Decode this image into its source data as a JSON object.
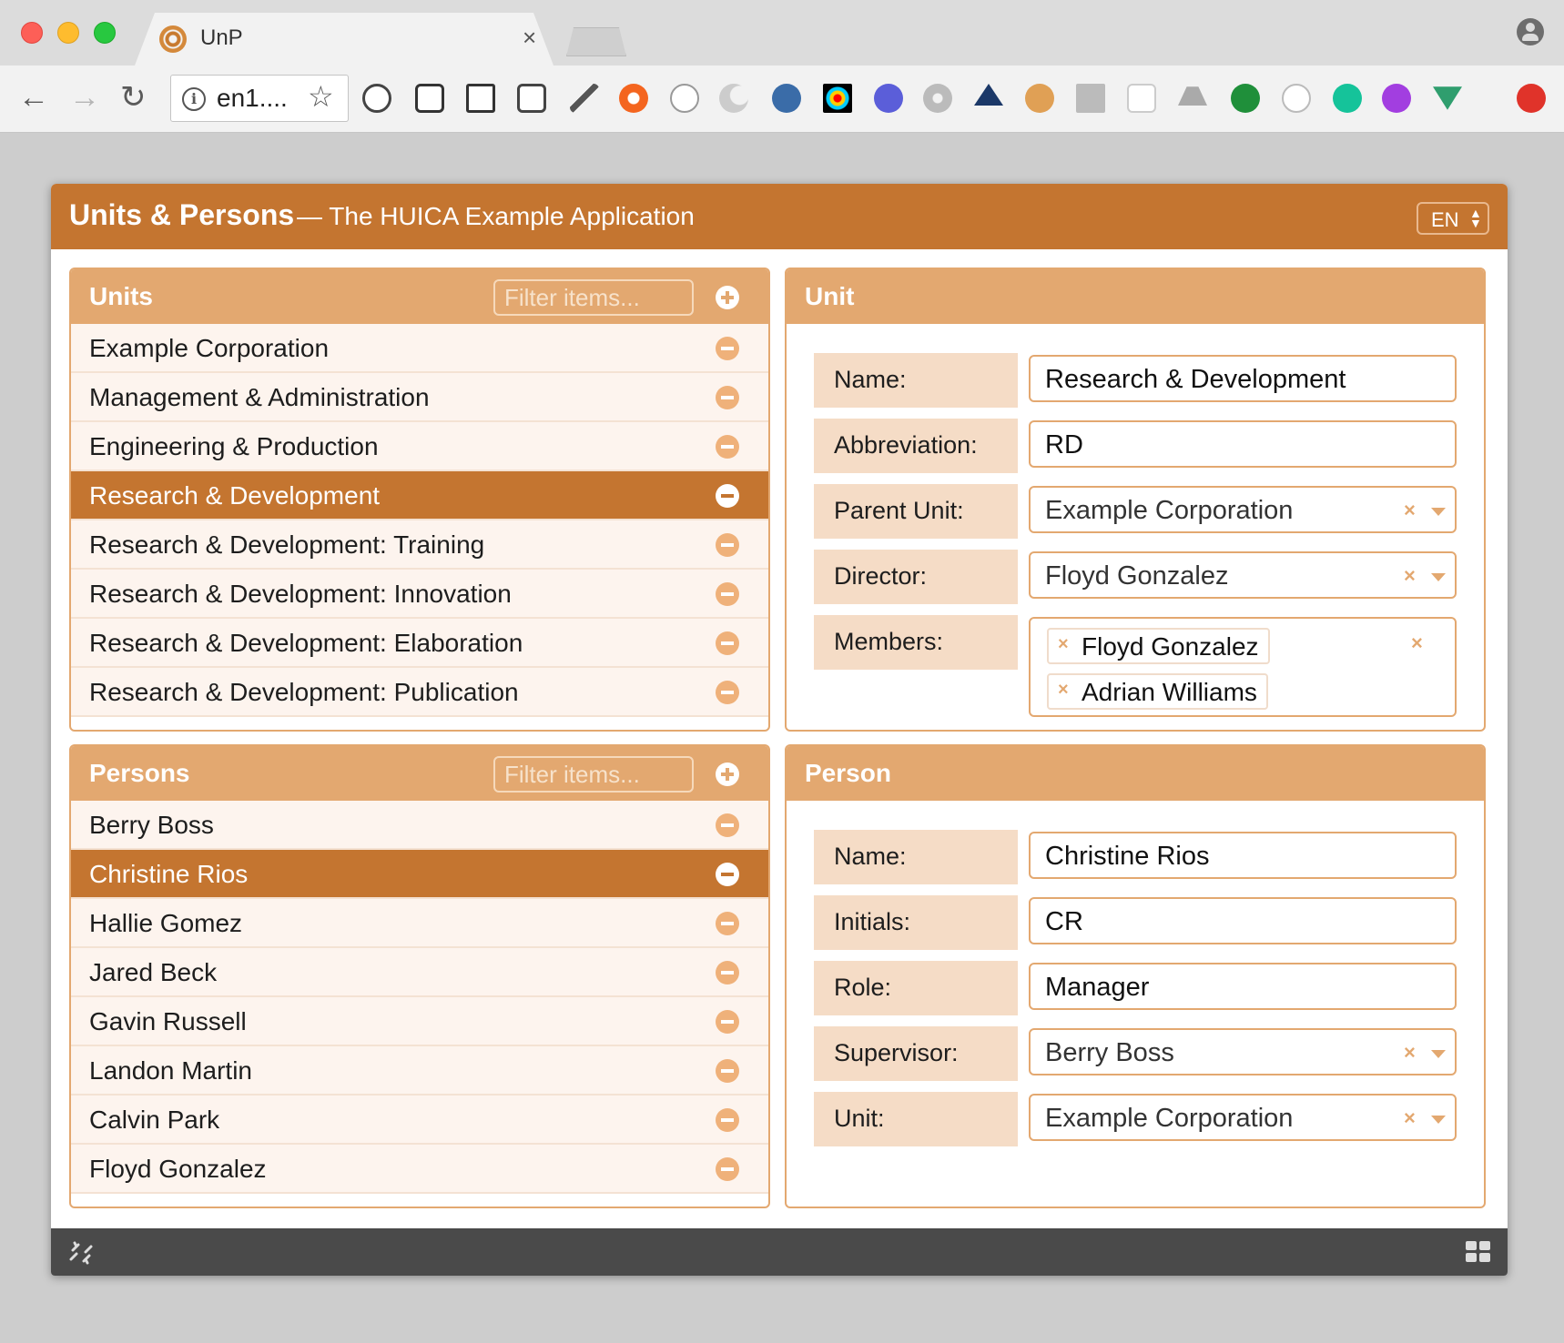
{
  "browser": {
    "tab_title": "UnP",
    "tab_close": "×",
    "url": "en1....",
    "nav": {
      "back": "←",
      "forward": "→",
      "reload": "↻",
      "star": "☆",
      "info": "i"
    },
    "extensions": [
      "recycle-icon",
      "screenshot-icon",
      "cast-icon",
      "reader-icon",
      "eyedropper-icon",
      "lifebuoy-icon",
      "json-icon",
      "moon-icon",
      "cloud-badge-icon",
      "color-wheel-icon",
      "ws-icon",
      "gear-icon",
      "axe-icon",
      "cookie-icon",
      "clipper-icon",
      "graph-icon",
      "drive-icon",
      "magnifier-icon",
      "a-icon",
      "grammarly-icon",
      "robot-icon",
      "vue-icon",
      "upload-icon"
    ]
  },
  "app": {
    "title": "Units & Persons",
    "subtitle": "— The HUICA Example Application",
    "language": "EN",
    "colors": {
      "primary": "#c47530",
      "light": "#e3a870",
      "label_bg": "#f5dcc6",
      "footer": "#4a4a4a"
    }
  },
  "units_panel": {
    "title": "Units",
    "filter_placeholder": "Filter items...",
    "items": [
      {
        "label": "Example Corporation",
        "selected": false
      },
      {
        "label": "Management & Administration",
        "selected": false
      },
      {
        "label": "Engineering & Production",
        "selected": false
      },
      {
        "label": "Research & Development",
        "selected": true
      },
      {
        "label": "Research & Development: Training",
        "selected": false
      },
      {
        "label": "Research & Development: Innovation",
        "selected": false
      },
      {
        "label": "Research & Development: Elaboration",
        "selected": false
      },
      {
        "label": "Research & Development: Publication",
        "selected": false
      }
    ]
  },
  "persons_panel": {
    "title": "Persons",
    "filter_placeholder": "Filter items...",
    "items": [
      {
        "label": "Berry Boss",
        "selected": false
      },
      {
        "label": "Christine Rios",
        "selected": true
      },
      {
        "label": "Hallie Gomez",
        "selected": false
      },
      {
        "label": "Jared Beck",
        "selected": false
      },
      {
        "label": "Gavin Russell",
        "selected": false
      },
      {
        "label": "Landon Martin",
        "selected": false
      },
      {
        "label": "Calvin Park",
        "selected": false
      },
      {
        "label": "Floyd Gonzalez",
        "selected": false
      }
    ]
  },
  "unit_form": {
    "title": "Unit",
    "name_label": "Name:",
    "name_value": "Research & Development",
    "abbr_label": "Abbreviation:",
    "abbr_value": "RD",
    "parent_label": "Parent Unit:",
    "parent_value": "Example Corporation",
    "director_label": "Director:",
    "director_value": "Floyd Gonzalez",
    "members_label": "Members:",
    "members": [
      "Floyd Gonzalez",
      "Adrian Williams"
    ],
    "clear_glyph": "×"
  },
  "person_form": {
    "title": "Person",
    "name_label": "Name:",
    "name_value": "Christine Rios",
    "initials_label": "Initials:",
    "initials_value": "CR",
    "role_label": "Role:",
    "role_value": "Manager",
    "supervisor_label": "Supervisor:",
    "supervisor_value": "Berry Boss",
    "unit_label": "Unit:",
    "unit_value": "Example Corporation",
    "clear_glyph": "×"
  },
  "footer": {
    "left_icon": "disconnect-icon",
    "right_icon": "grid-icon"
  }
}
